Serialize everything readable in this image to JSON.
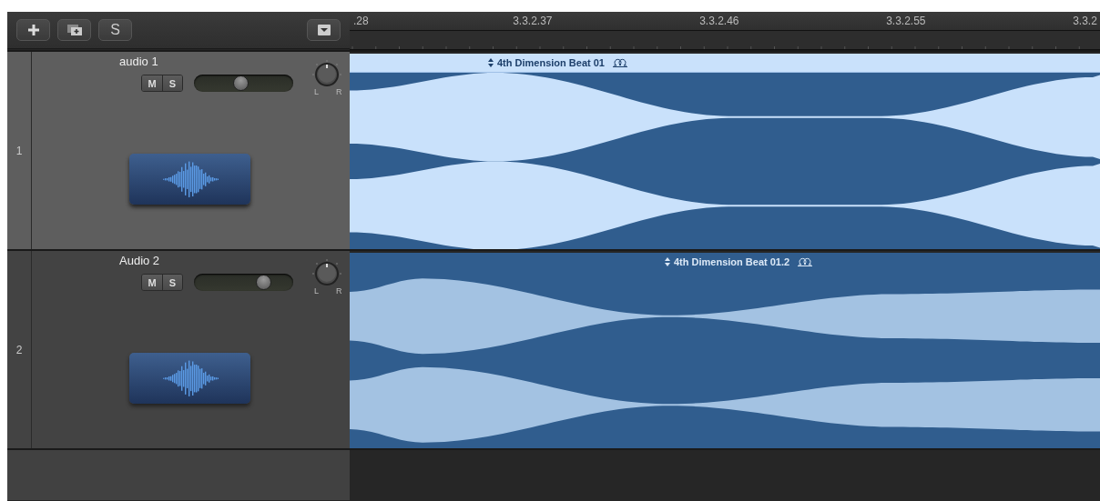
{
  "toolbar": {
    "solo_button": "S"
  },
  "ruler": {
    "labels": [
      ".28",
      "3.3.2.37",
      "3.3.2.46",
      "3.3.2.55",
      "3.3.2"
    ]
  },
  "tracks": [
    {
      "number": "1",
      "name": "audio 1",
      "selected": true,
      "mute": {
        "label": "M",
        "on": false
      },
      "solo": {
        "label": "S",
        "on": false
      },
      "volume": {
        "level": 0.47
      },
      "pan": {
        "left": "L",
        "right": "R"
      },
      "region": {
        "name": "4th Dimension Beat 01",
        "selected": true
      }
    },
    {
      "number": "2",
      "name": "Audio 2",
      "selected": false,
      "mute": {
        "label": "M",
        "on": false
      },
      "solo": {
        "label": "S",
        "on": false
      },
      "volume": {
        "level": 0.74
      },
      "pan": {
        "left": "L",
        "right": "R"
      },
      "region": {
        "name": "4th Dimension Beat 01.2",
        "selected": false
      }
    }
  ]
}
